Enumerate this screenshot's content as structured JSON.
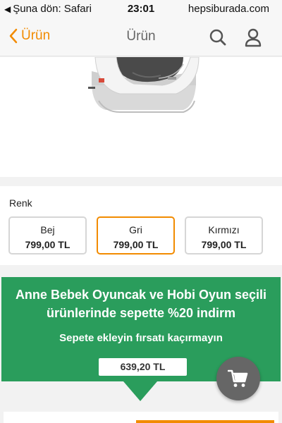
{
  "status_bar": {
    "back_label": "Şuna dön: Safari",
    "time": "23:01",
    "domain": "hepsiburada.com"
  },
  "nav": {
    "back_label": "Ürün",
    "title": "Ürün",
    "accent_color": "#f28b00"
  },
  "product": {
    "image_icon": "car-seat-image"
  },
  "color_selector": {
    "heading": "Renk",
    "selected_index": 1,
    "options": [
      {
        "name": "Bej",
        "price": "799,00 TL"
      },
      {
        "name": "Gri",
        "price": "799,00 TL"
      },
      {
        "name": "Kırmızı",
        "price": "799,00 TL"
      }
    ]
  },
  "promo": {
    "title": "Anne Bebek Oyuncak ve Hobi Oyun seçili ürünlerinde sepette %20 indirm",
    "subtitle": "Sepete ekleyin fırsatı kaçırmayın",
    "price": "639,20 TL",
    "color": "#2a9d5c"
  },
  "cart_button": {
    "icon": "cart-icon"
  }
}
